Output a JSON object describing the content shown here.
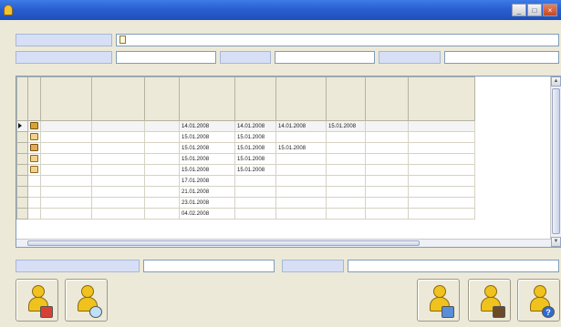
{
  "window": {
    "title": "",
    "controls": [
      "_",
      "□",
      "×"
    ]
  },
  "info": {
    "process_label": "",
    "process_value": "",
    "initiator_label": "",
    "initiator_value": "",
    "type_label": "",
    "type_value": "",
    "state_label": "",
    "state_value": ""
  },
  "table": {
    "columns": [
      "",
      "",
      "",
      "",
      "",
      "",
      "",
      "",
      ""
    ],
    "rows": [
      {
        "icon": "edit-icon",
        "selected": true,
        "cells": [
          "",
          "",
          "",
          "14.01.2008",
          "14.01.2008",
          "14.01.2008",
          "15.01.2008",
          "",
          ""
        ]
      },
      {
        "icon": "mail-icon",
        "selected": false,
        "cells": [
          "",
          "",
          "",
          "15.01.2008",
          "15.01.2008",
          "",
          "",
          "",
          ""
        ]
      },
      {
        "icon": "sign-icon",
        "selected": false,
        "cells": [
          "",
          "",
          "",
          "15.01.2008",
          "15.01.2008",
          "15.01.2008",
          "",
          "",
          ""
        ]
      },
      {
        "icon": "mail-icon",
        "selected": false,
        "cells": [
          "",
          "",
          "",
          "15.01.2008",
          "15.01.2008",
          "",
          "",
          "",
          ""
        ]
      },
      {
        "icon": "mail-icon",
        "selected": false,
        "cells": [
          "",
          "",
          "",
          "15.01.2008",
          "15.01.2008",
          "",
          "",
          "",
          ""
        ]
      },
      {
        "icon": "",
        "selected": false,
        "cells": [
          "",
          "",
          "",
          "17.01.2008",
          "",
          "",
          "",
          "",
          ""
        ]
      },
      {
        "icon": "",
        "selected": false,
        "cells": [
          "",
          "",
          "",
          "21.01.2008",
          "",
          "",
          "",
          "",
          ""
        ]
      },
      {
        "icon": "",
        "selected": false,
        "cells": [
          "",
          "",
          "",
          "23.01.2008",
          "",
          "",
          "",
          "",
          ""
        ]
      },
      {
        "icon": "",
        "selected": false,
        "cells": [
          "",
          "",
          "",
          "04.02.2008",
          "",
          "",
          "",
          "",
          ""
        ]
      }
    ]
  },
  "footer": {
    "notify_label": "",
    "notify_value": "",
    "author_label": "",
    "author_value": ""
  },
  "toolbar": {
    "buttons": [
      "add-participant-icon",
      "find-participant-icon",
      "send-icon",
      "archive-icon",
      "help-icon"
    ]
  }
}
